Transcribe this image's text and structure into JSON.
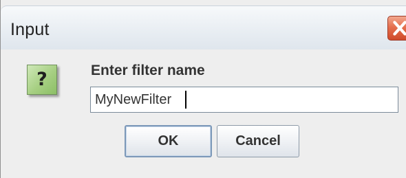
{
  "dialog": {
    "title": "Input",
    "icon": "question-icon",
    "icon_glyph": "?",
    "prompt": "Enter filter name",
    "input_value": "MyNewFilter",
    "buttons": {
      "ok_label": "OK",
      "cancel_label": "Cancel"
    },
    "close_icon": "close-icon"
  },
  "colors": {
    "close_button": "#e56f4e",
    "question_icon": "#a6cf82",
    "background": "#eeeeee"
  }
}
